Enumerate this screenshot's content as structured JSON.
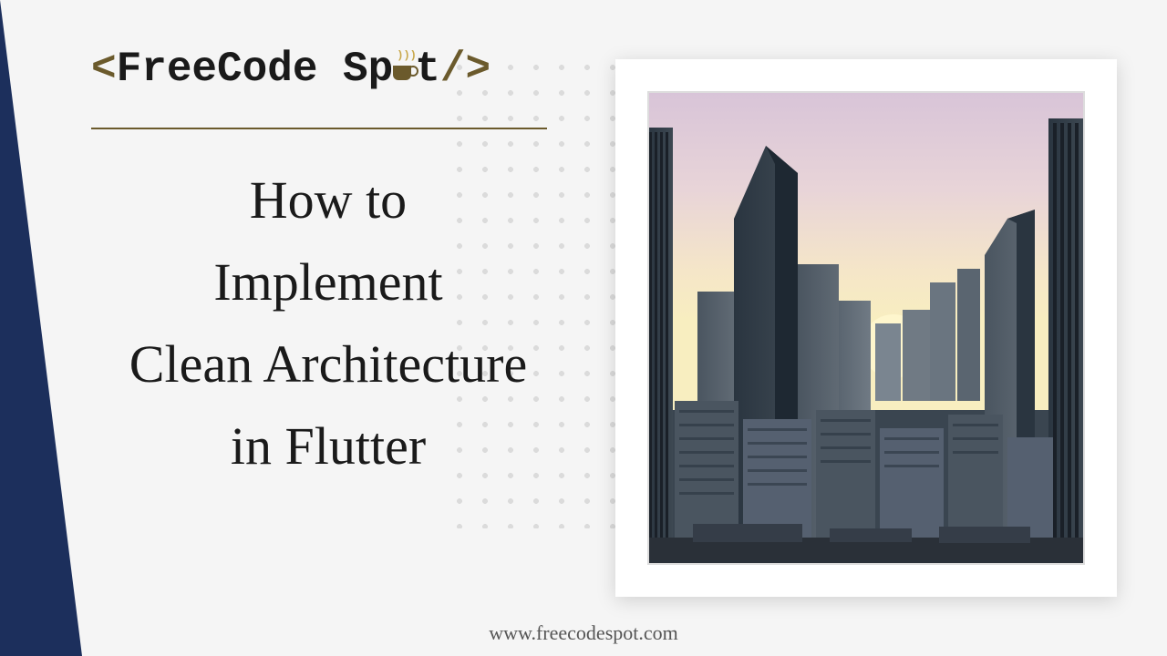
{
  "logo": {
    "open_bracket": "<",
    "text_free": "FreeCode Sp",
    "text_after_mug": "t",
    "close_bracket": "/>"
  },
  "title": {
    "line1": "How to",
    "line2": "Implement",
    "line3": "Clean Architecture",
    "line4": "in Flutter"
  },
  "footer": {
    "url": "www.freecodespot.com"
  },
  "image": {
    "alt": "city-skyline"
  }
}
